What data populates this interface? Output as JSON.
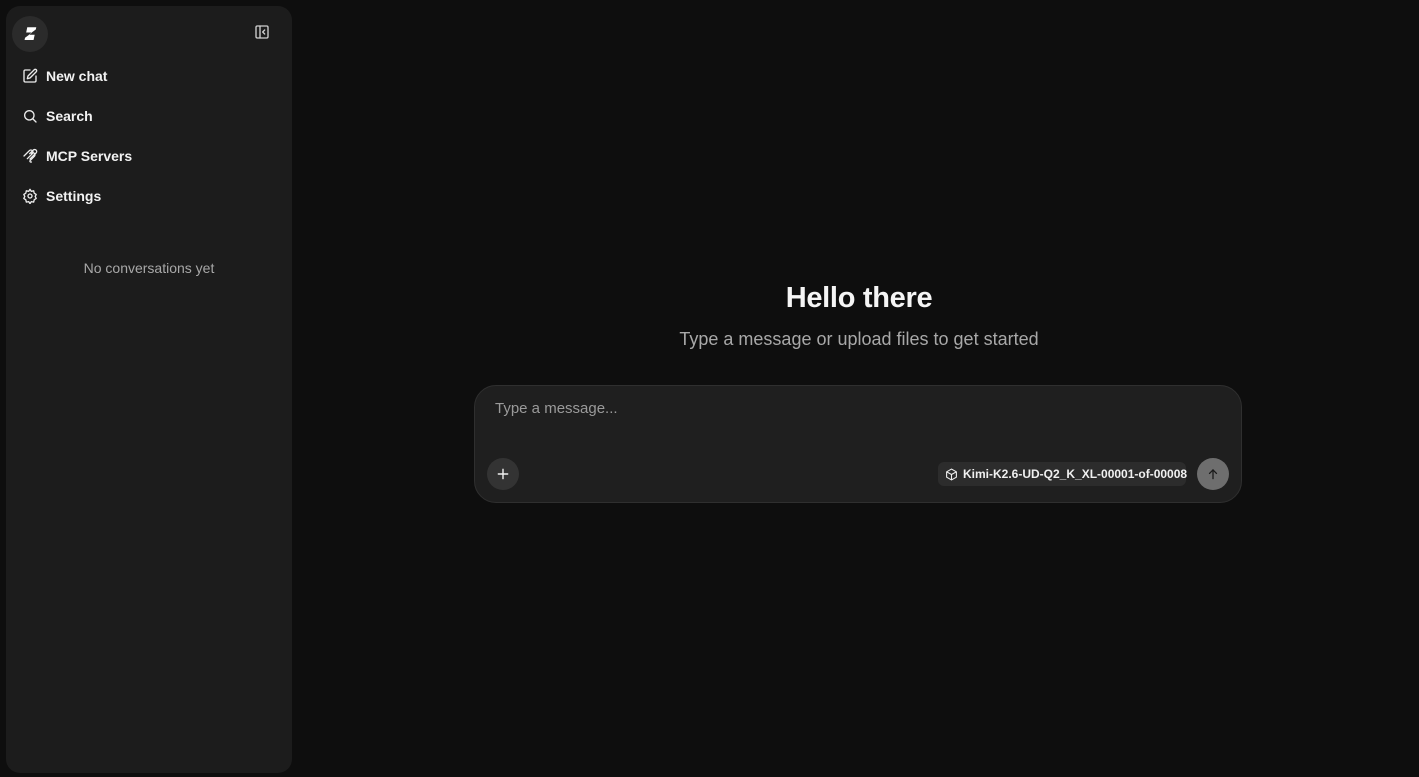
{
  "sidebar": {
    "logo_icon": "lightning-logo-icon",
    "collapse_icon": "sidebar-collapse-icon",
    "items": [
      {
        "label": "New chat",
        "icon": "edit-icon"
      },
      {
        "label": "Search",
        "icon": "search-icon"
      },
      {
        "label": "MCP Servers",
        "icon": "mcp-icon"
      },
      {
        "label": "Settings",
        "icon": "gear-icon"
      }
    ],
    "empty_text": "No conversations yet"
  },
  "main": {
    "title": "Hello there",
    "subtitle": "Type a message or upload files to get started"
  },
  "composer": {
    "placeholder": "Type a message...",
    "value": "",
    "attach_icon": "plus-icon",
    "model_icon": "cube-icon",
    "model_name": "Kimi-K2.6-UD-Q2_K_XL-00001-of-00008",
    "send_icon": "arrow-up-icon"
  },
  "colors": {
    "background": "#0e0e0e",
    "sidebar": "#1c1c1c",
    "composer": "#1f1f1f",
    "send_button": "#6e6e6e"
  }
}
